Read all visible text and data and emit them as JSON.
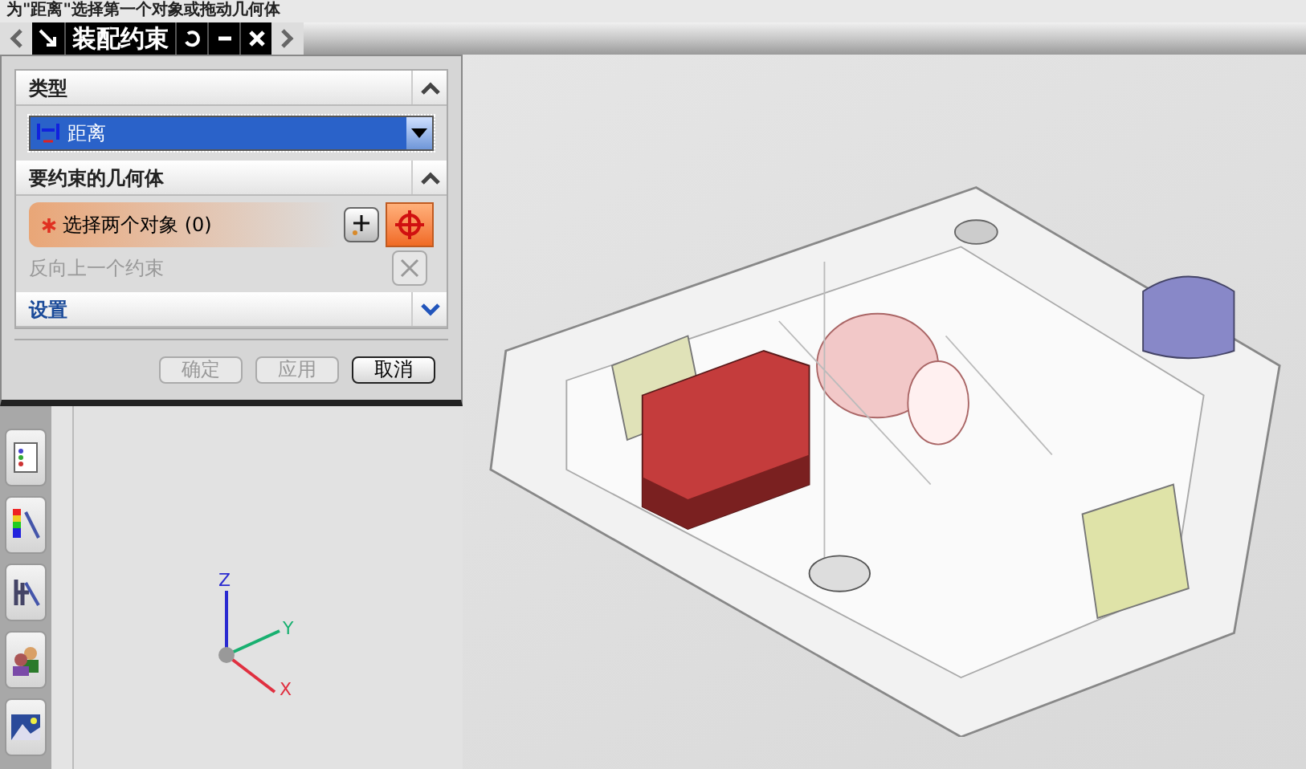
{
  "cue_line": "为\"距离\"选择第一个对象或拖动几何体",
  "dialog": {
    "title": "装配约束",
    "sections": [
      {
        "kind": "type",
        "title": "类型",
        "expanded": true,
        "value": "距离"
      },
      {
        "kind": "geometry",
        "title": "要约束的几何体",
        "expanded": true,
        "select_label": "选择两个对象",
        "count": "(0)",
        "reverse_label": "反向上一个约束",
        "reverse_disabled": true
      },
      {
        "title": "设置",
        "expanded": false
      }
    ],
    "buttons": [
      {
        "label": "确定",
        "disabled": true
      },
      {
        "label": "应用",
        "disabled": true
      },
      {
        "label": "取消",
        "disabled": false
      }
    ]
  },
  "triad": {
    "x": "X",
    "y": "Y",
    "z": "Z"
  }
}
